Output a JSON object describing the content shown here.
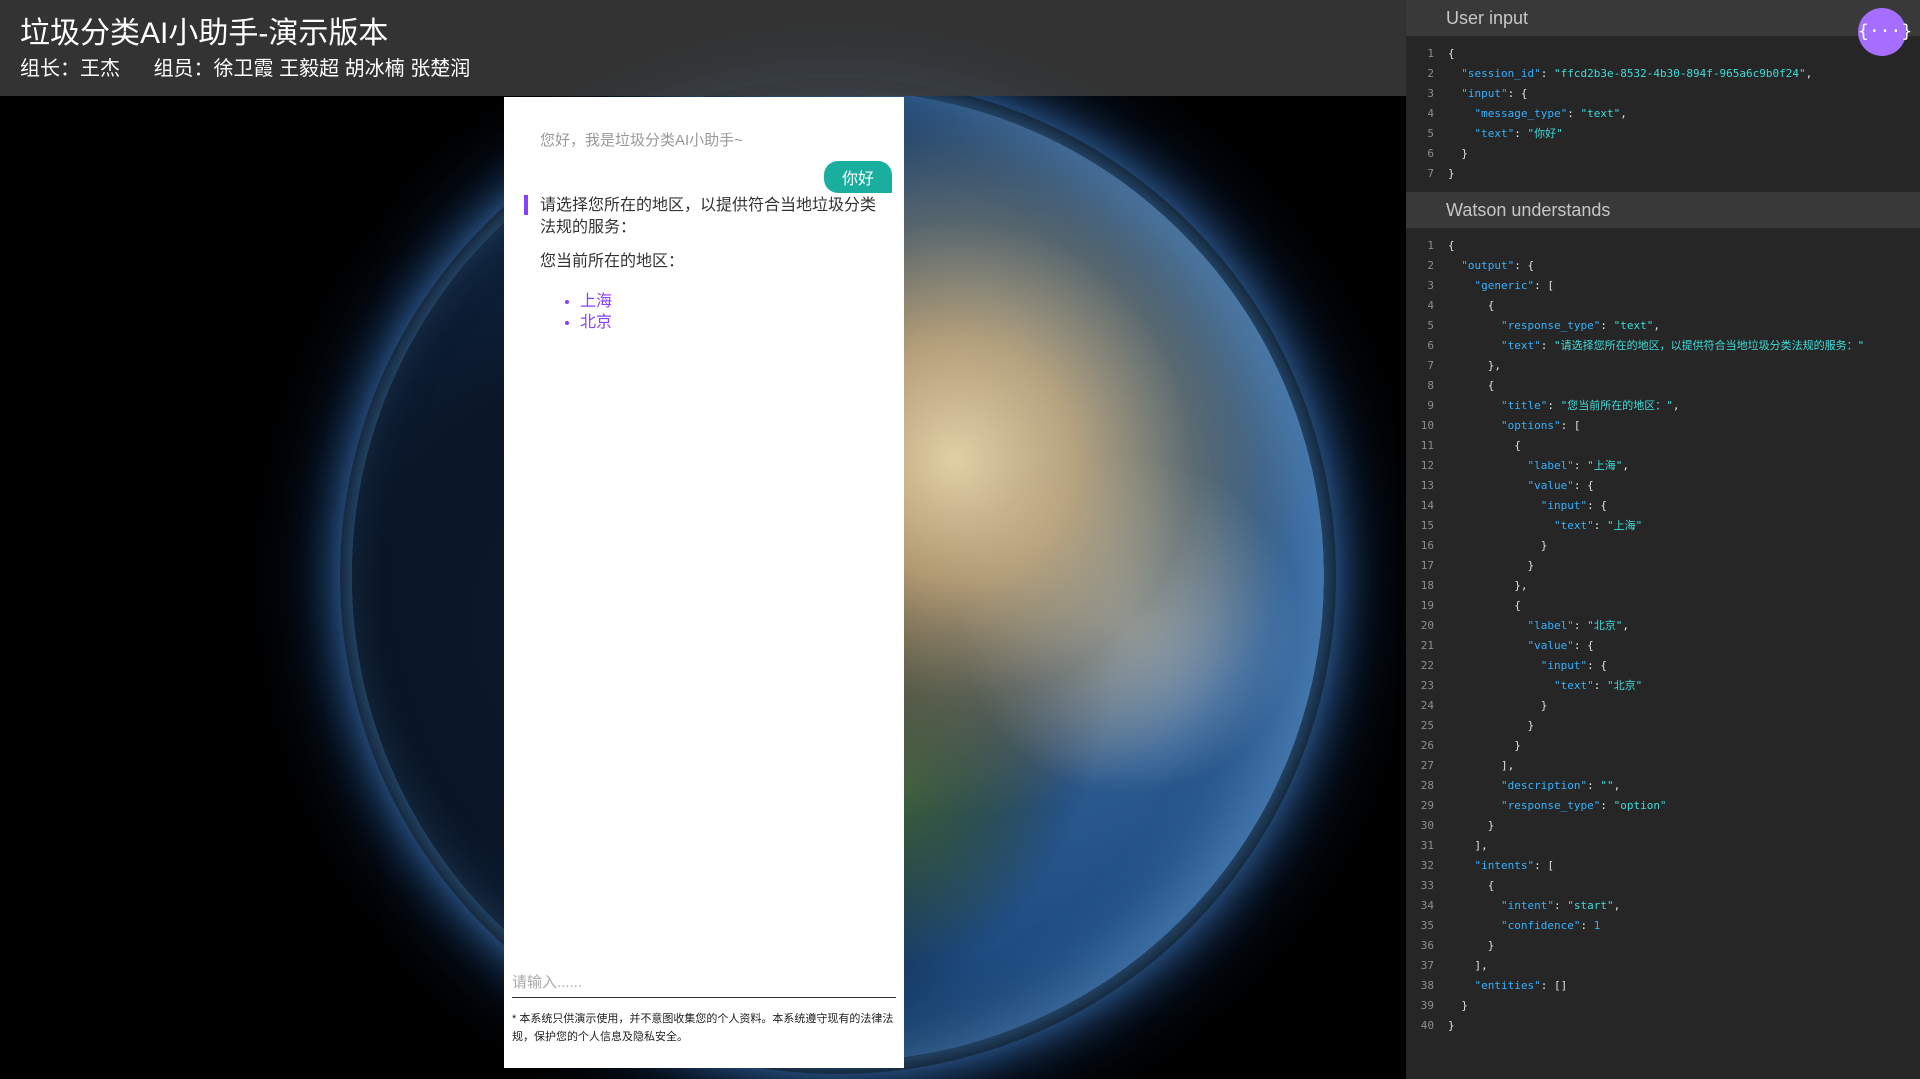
{
  "header": {
    "title": "垃圾分类AI小助手-演示版本",
    "leader": "组长：王杰",
    "members": "组员：徐卫霞 王毅超 胡冰楠 张楚润"
  },
  "chat": {
    "greeting": "您好，我是垃圾分类AI小助手~",
    "user_message": "你好",
    "bot_text": "请选择您所在的地区，以提供符合当地垃圾分类法规的服务：",
    "bot_title": "您当前所在的地区：",
    "options": [
      "上海",
      "北京"
    ],
    "input_placeholder": "请输入......",
    "disclaimer": "* 本系统只供演示使用，并不意图收集您的个人资料。本系统遵守现有的法律法规，保护您的个人信息及隐私安全。"
  },
  "panel": {
    "user_input_title": "User input",
    "watson_title": "Watson understands",
    "fab_icon": "{···}",
    "user_input_lines": [
      "{",
      "  \"session_id\": \"ffcd2b3e-8532-4b30-894f-965a6c9b0f24\",",
      "  \"input\": {",
      "    \"message_type\": \"text\",",
      "    \"text\": \"你好\"",
      "  }",
      "}"
    ],
    "watson_lines": [
      "{",
      "  \"output\": {",
      "    \"generic\": [",
      "      {",
      "        \"response_type\": \"text\",",
      "        \"text\": \"请选择您所在的地区，以提供符合当地垃圾分类法规的服务：\"",
      "      },",
      "      {",
      "        \"title\": \"您当前所在的地区：\",",
      "        \"options\": [",
      "          {",
      "            \"label\": \"上海\",",
      "            \"value\": {",
      "              \"input\": {",
      "                \"text\": \"上海\"",
      "              }",
      "            }",
      "          },",
      "          {",
      "            \"label\": \"北京\",",
      "            \"value\": {",
      "              \"input\": {",
      "                \"text\": \"北京\"",
      "              }",
      "            }",
      "          }",
      "        ],",
      "        \"description\": \"\",",
      "        \"response_type\": \"option\"",
      "      }",
      "    ],",
      "    \"intents\": [",
      "      {",
      "        \"intent\": \"start\",",
      "        \"confidence\": 1",
      "      }",
      "    ],",
      "    \"entities\": []",
      "  }",
      "}"
    ]
  }
}
